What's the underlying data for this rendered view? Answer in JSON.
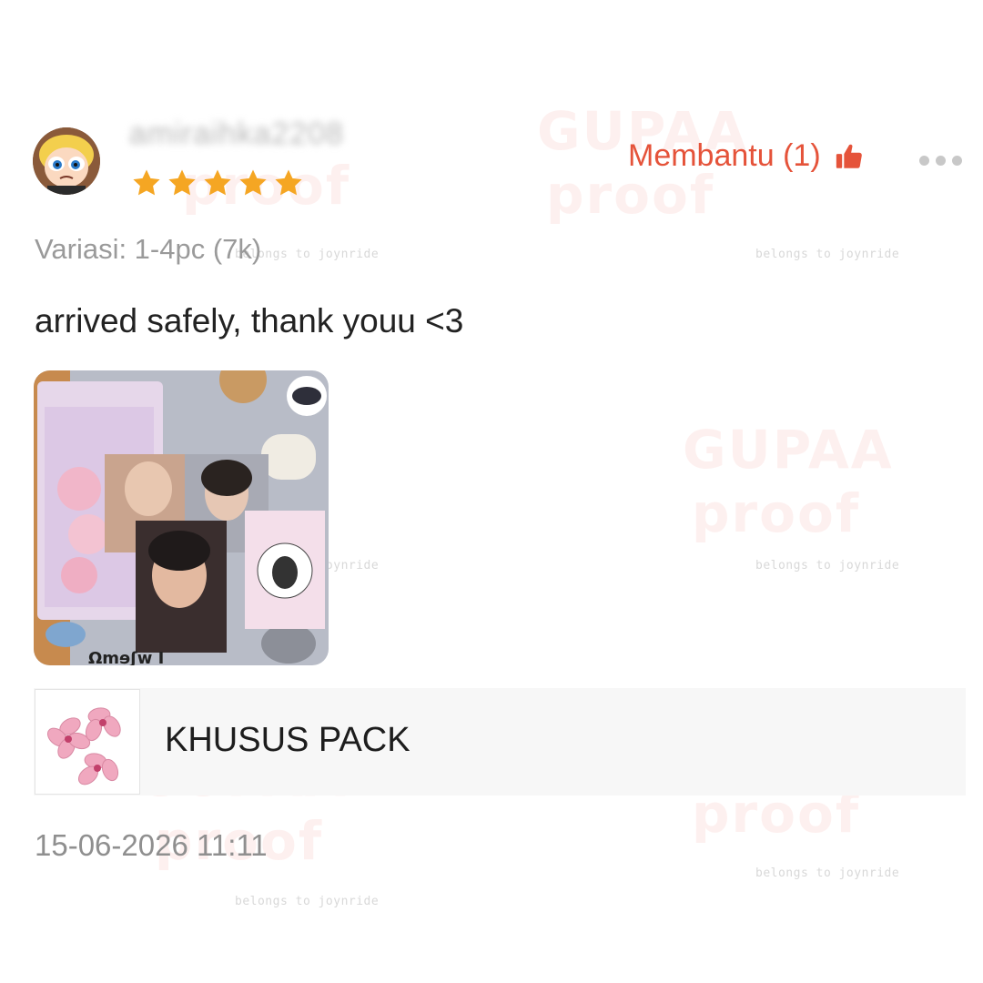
{
  "review": {
    "username": "amiraihka2208",
    "rating": 5,
    "helpful_label": "Membantu (1)",
    "variation": "Variasi: 1-4pc (7k)",
    "text": "arrived safely, thank youu <3",
    "timestamp": "15-06-2026 11:11"
  },
  "product": {
    "name": "KHUSUS PACK"
  },
  "watermark": {
    "word_top": "GUPAA",
    "word_bottom": "proof",
    "caption": "belongs to joynride"
  },
  "colors": {
    "accent": "#e5533a",
    "star": "#f5a623",
    "muted_text": "#9a9a9a",
    "watermark": "#fde4e2"
  },
  "icons": {
    "thumb": "thumbs-up-icon",
    "more": "more-dots-icon",
    "star": "star-icon"
  }
}
